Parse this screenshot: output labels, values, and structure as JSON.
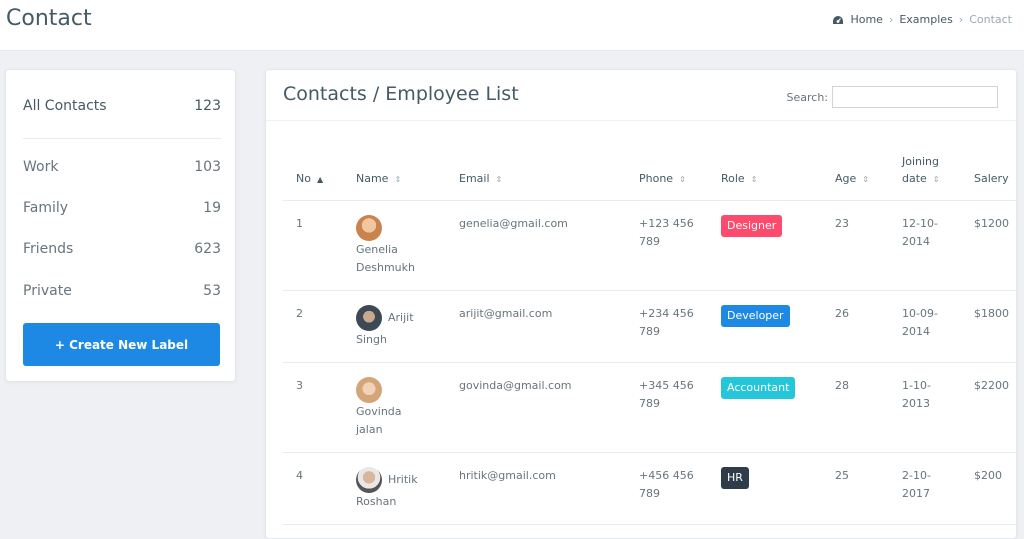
{
  "header": {
    "title": "Contact",
    "breadcrumb": {
      "home": "Home",
      "examples": "Examples",
      "current": "Contact"
    }
  },
  "sidebar": {
    "labels": [
      {
        "name": "All Contacts",
        "count": "123"
      },
      {
        "name": "Work",
        "count": "103"
      },
      {
        "name": "Family",
        "count": "19"
      },
      {
        "name": "Friends",
        "count": "623"
      },
      {
        "name": "Private",
        "count": "53"
      }
    ],
    "create_button": "+ Create New Label"
  },
  "main": {
    "title": "Contacts / Employee List",
    "search_label": "Search:",
    "search_value": "",
    "columns": {
      "no": "No",
      "name": "Name",
      "email": "Email",
      "phone": "Phone",
      "role": "Role",
      "age": "Age",
      "joining_line1": "Joining",
      "joining_line2": "date",
      "salary": "Salery"
    },
    "rows": [
      {
        "no": "1",
        "name1": "Genelia",
        "name2": "Deshmukh",
        "email": "genelia@gmail.com",
        "phone1": "+123 456",
        "phone2": "789",
        "role": "Designer",
        "role_color": "#fc4b6c",
        "age": "23",
        "date1": "12-10-",
        "date2": "2014",
        "salary": "$1200"
      },
      {
        "no": "2",
        "name1": "Arijit",
        "name2": "Singh",
        "email": "arijit@gmail.com",
        "phone1": "+234 456",
        "phone2": "789",
        "role": "Developer",
        "role_color": "#1e88e5",
        "age": "26",
        "date1": "10-09-",
        "date2": "2014",
        "salary": "$1800"
      },
      {
        "no": "3",
        "name1": "Govinda",
        "name2": "jalan",
        "email": "govinda@gmail.com",
        "phone1": "+345 456",
        "phone2": "789",
        "role": "Accountant",
        "role_color": "#26c6da",
        "age": "28",
        "date1": "1-10-",
        "date2": "2013",
        "salary": "$2200"
      },
      {
        "no": "4",
        "name1": "Hritik",
        "name2": "Roshan",
        "email": "hritik@gmail.com",
        "phone1": "+456 456",
        "phone2": "789",
        "role": "HR",
        "role_color": "#2f3d4a",
        "age": "25",
        "date1": "2-10-",
        "date2": "2017",
        "salary": "$200"
      }
    ]
  }
}
